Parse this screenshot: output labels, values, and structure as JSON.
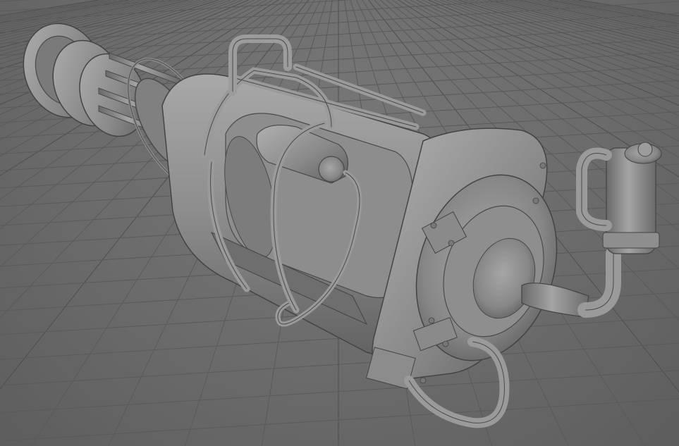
{
  "viewport": {
    "background_color": "#6b6b6b",
    "grid_line_color": "#5a5a5a",
    "grid_major_color": "#4e4e4e",
    "model_base_color": "#8f8f8f",
    "model_shadow_color": "#5c5c5c",
    "model_highlight_color": "#b4b4b4",
    "model_name": "minigun-3d-model",
    "shading_mode": "smooth-shade-gray"
  }
}
